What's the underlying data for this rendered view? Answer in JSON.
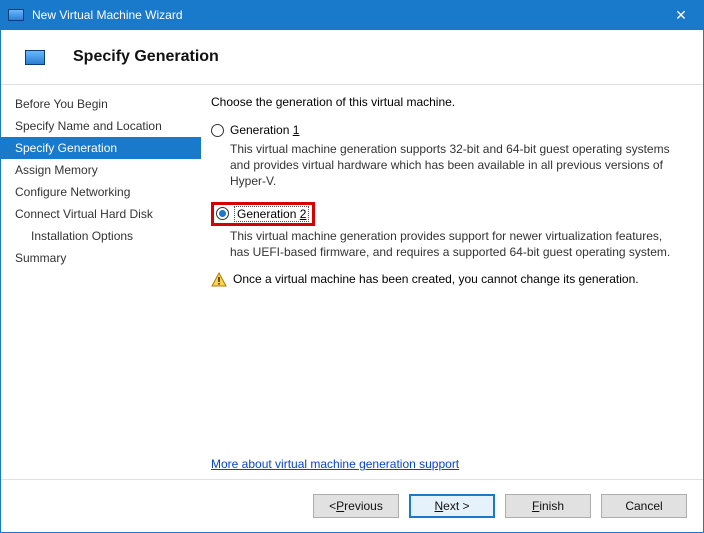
{
  "window": {
    "title": "New Virtual Machine Wizard"
  },
  "page": {
    "heading": "Specify Generation"
  },
  "steps": {
    "s0": "Before You Begin",
    "s1": "Specify Name and Location",
    "s2": "Specify Generation",
    "s3": "Assign Memory",
    "s4": "Configure Networking",
    "s5": "Connect Virtual Hard Disk",
    "s6": "Installation Options",
    "s7": "Summary"
  },
  "content": {
    "instruction": "Choose the generation of this virtual machine.",
    "gen1_label_pre": "Generation ",
    "gen1_label_m": "1",
    "gen1_desc": "This virtual machine generation supports 32-bit and 64-bit guest operating systems and provides virtual hardware which has been available in all previous versions of Hyper-V.",
    "gen2_label_pre": "Generation ",
    "gen2_label_m": "2",
    "gen2_desc": "This virtual machine generation provides support for newer virtualization features, has UEFI-based firmware, and requires a supported 64-bit guest operating system.",
    "warning": "Once a virtual machine has been created, you cannot change its generation.",
    "more_link": "More about virtual machine generation support"
  },
  "buttons": {
    "prev_pre": "< ",
    "prev_m": "P",
    "prev_post": "revious",
    "next_m": "N",
    "next_post": "ext >",
    "finish_m": "F",
    "finish_post": "inish",
    "cancel": "Cancel"
  }
}
